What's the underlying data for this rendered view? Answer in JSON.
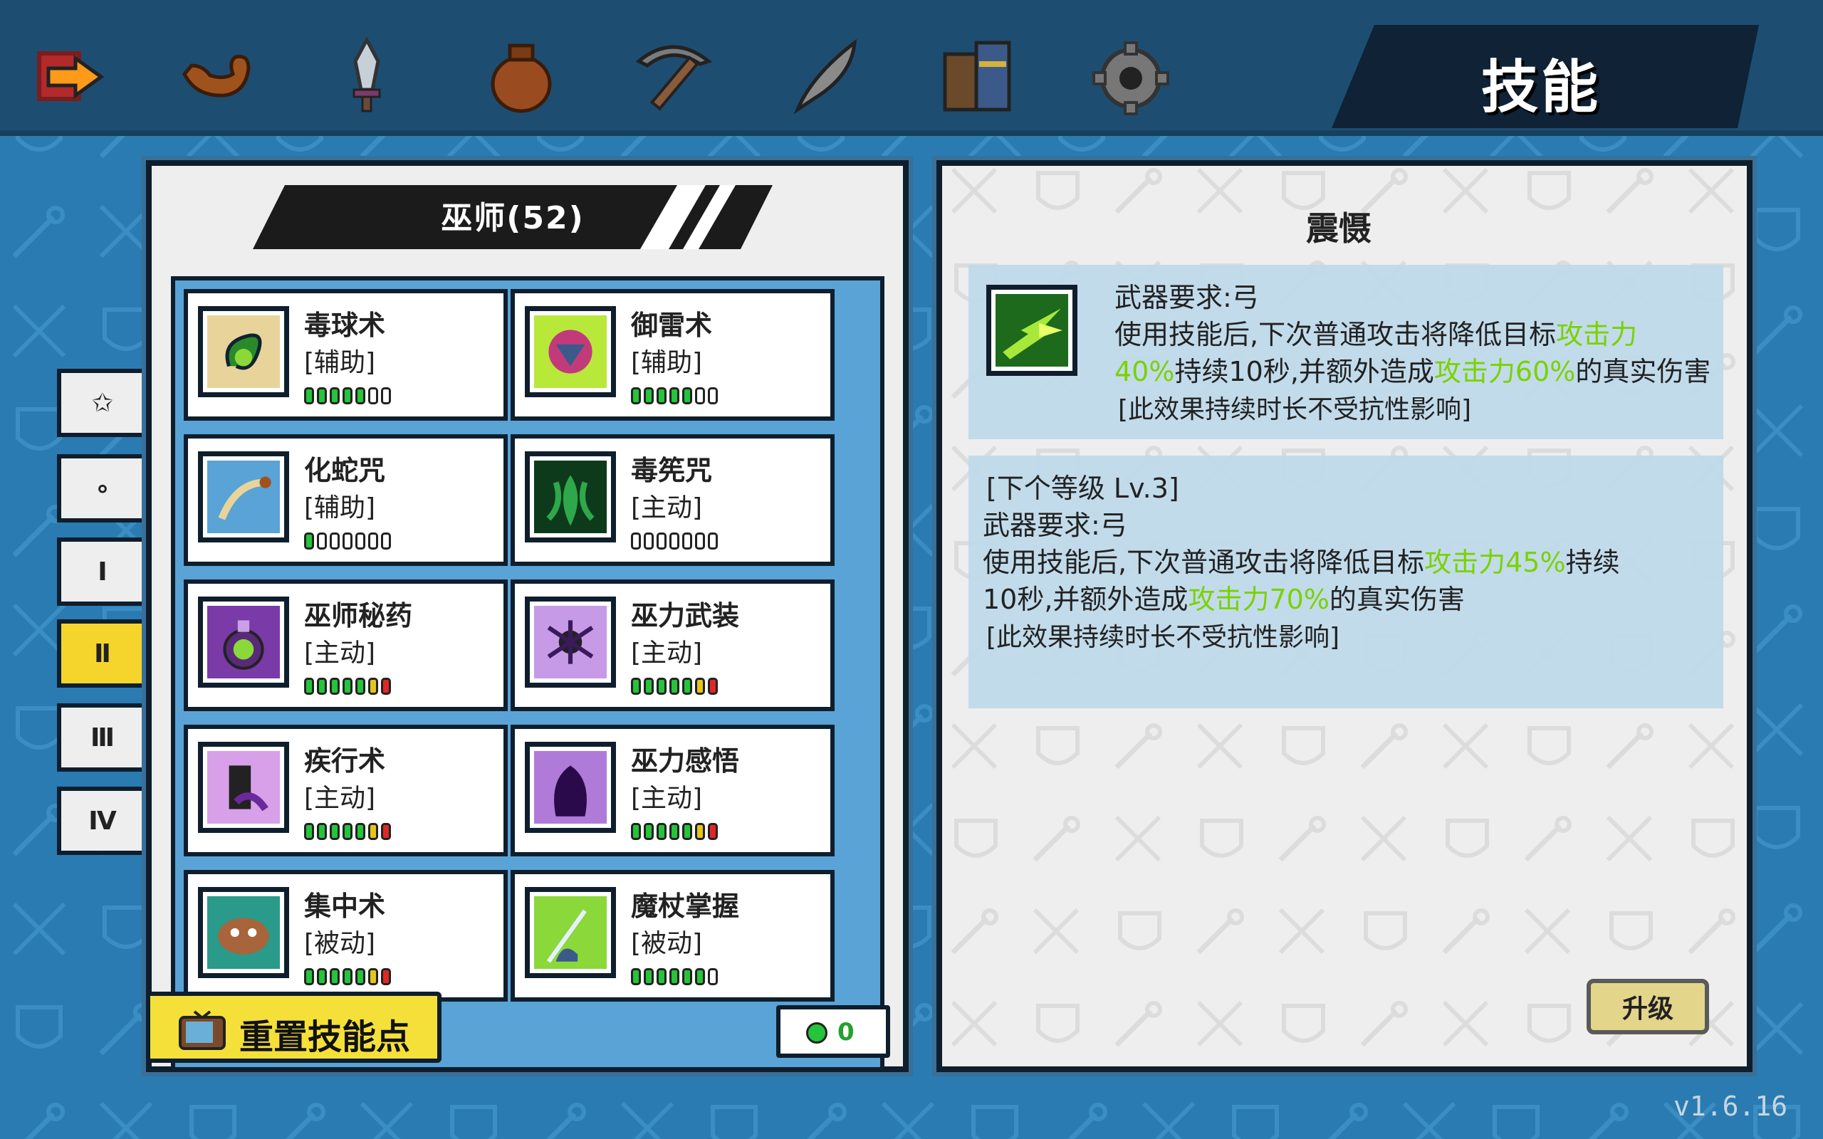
{
  "header": {
    "title": "技能",
    "tabs": [
      {
        "icon": "exit-arrow-icon",
        "color": "#e3342f"
      },
      {
        "icon": "arm-strength-icon",
        "color": "#a0521d"
      },
      {
        "icon": "sword-icon",
        "color": "#9aa3ad"
      },
      {
        "icon": "pouch-icon",
        "color": "#9a4b20"
      },
      {
        "icon": "pickaxe-icon",
        "color": "#6e5a4a"
      },
      {
        "icon": "feather-icon",
        "color": "#6d6d6d"
      },
      {
        "icon": "books-icon",
        "color": "#3b5a8a"
      },
      {
        "icon": "settings-gear-icon",
        "color": "#777777"
      }
    ]
  },
  "skill_tree": {
    "class_label": "巫师(52)",
    "tiers": [
      "✩",
      "∘",
      "Ⅰ",
      "Ⅱ",
      "Ⅲ",
      "Ⅳ"
    ],
    "active_tier": "Ⅱ",
    "skills": [
      {
        "name": "毒球术",
        "type": "[辅助]",
        "dots": [
          "g",
          "g",
          "g",
          "g",
          "g",
          "e",
          "e"
        ]
      },
      {
        "name": "御雷术",
        "type": "[辅助]",
        "dots": [
          "g",
          "g",
          "g",
          "g",
          "g",
          "e",
          "e"
        ]
      },
      {
        "name": "化蛇咒",
        "type": "[辅助]",
        "dots": [
          "g",
          "e",
          "e",
          "e",
          "e",
          "e",
          "e"
        ]
      },
      {
        "name": "毒筅咒",
        "type": "[主动]",
        "dots": [
          "e",
          "e",
          "e",
          "e",
          "e",
          "e",
          "e"
        ]
      },
      {
        "name": "巫师秘药",
        "type": "[主动]",
        "dots": [
          "g",
          "g",
          "g",
          "g",
          "g",
          "y",
          "r"
        ]
      },
      {
        "name": "巫力武装",
        "type": "[主动]",
        "dots": [
          "g",
          "g",
          "g",
          "g",
          "g",
          "y",
          "r"
        ]
      },
      {
        "name": "疾行术",
        "type": "[主动]",
        "dots": [
          "g",
          "g",
          "g",
          "g",
          "g",
          "y",
          "r"
        ]
      },
      {
        "name": "巫力感悟",
        "type": "[主动]",
        "dots": [
          "g",
          "g",
          "g",
          "g",
          "g",
          "y",
          "r"
        ]
      },
      {
        "name": "集中术",
        "type": "[被动]",
        "dots": [
          "g",
          "g",
          "g",
          "g",
          "g",
          "y",
          "r"
        ]
      },
      {
        "name": "魔杖掌握",
        "type": "[被动]",
        "dots": [
          "g",
          "g",
          "g",
          "g",
          "g",
          "g",
          "e"
        ]
      }
    ],
    "reset_label": "重置技能点",
    "skill_points": "0"
  },
  "detail": {
    "skill_name": "震慑",
    "current": {
      "line1": "武器要求:弓",
      "line2_a": "使用技能后,下次普通攻击将降低目标",
      "line2_b": "攻击力",
      "line3_a": "40%",
      "line3_b": "持续10秒,并额外造成",
      "line3_c": "攻击力60%",
      "line3_d": "的真实伤害",
      "line4": "[此效果持续时长不受抗性影响]"
    },
    "next": {
      "header": "[下个等级 Lv.3]",
      "line1": "武器要求:弓",
      "line2_a": "使用技能后,下次普通攻击将降低目标",
      "line2_b": "攻击力45%",
      "line2_c": "持续",
      "line3_a": "10秒,并额外造成",
      "line3_b": "攻击力70%",
      "line3_c": "的真实伤害",
      "line4": "[此效果持续时长不受抗性影响]"
    },
    "upgrade_label": "升级"
  },
  "version": "v1.6.16",
  "colors": {
    "background": "#2a7bb2",
    "highlight": "#7ad200",
    "active_tab": "#f5d52c"
  }
}
